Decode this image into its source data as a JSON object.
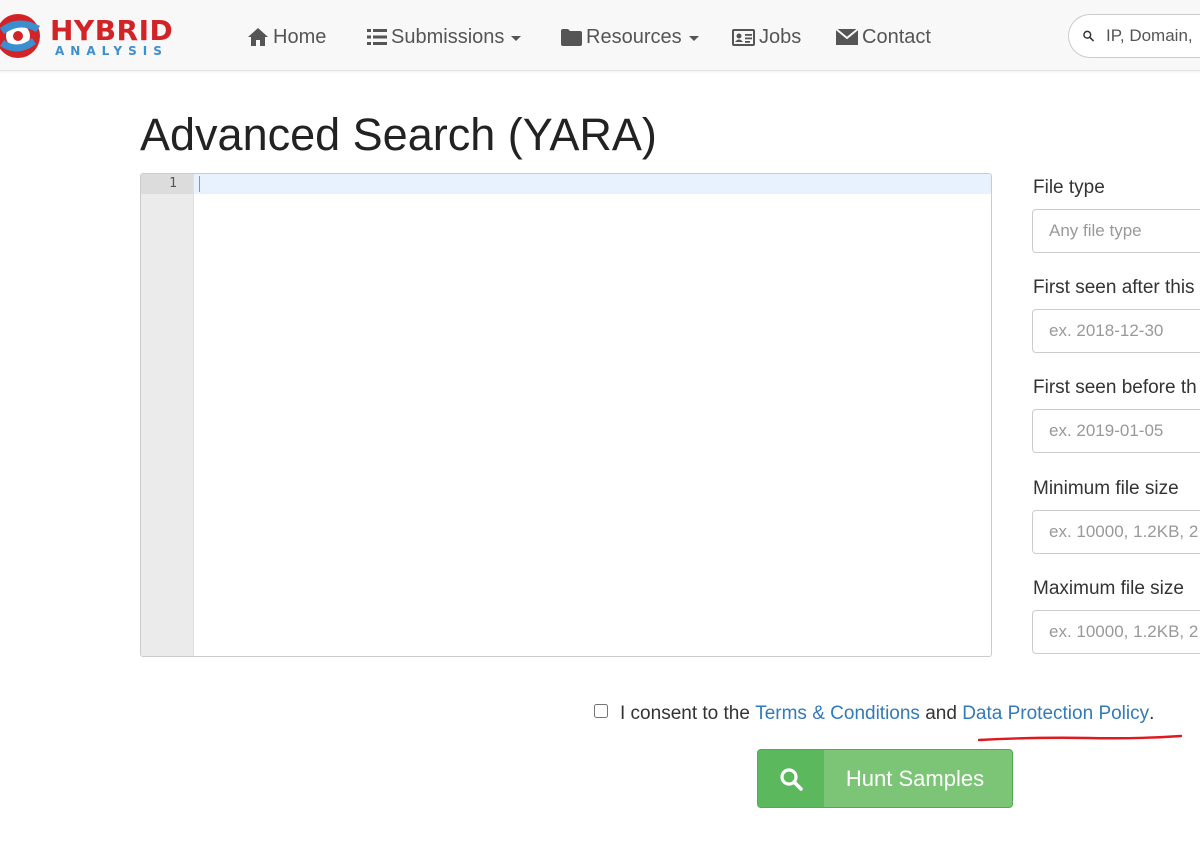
{
  "brand": {
    "name": "HYBRID",
    "tagline": "ANALYSIS"
  },
  "nav": {
    "items": [
      {
        "label": "Home",
        "icon": "home-icon"
      },
      {
        "label": "Submissions",
        "icon": "list-icon",
        "dropdown": true
      },
      {
        "label": "Resources",
        "icon": "folder-icon",
        "dropdown": true
      },
      {
        "label": "Jobs",
        "icon": "id-card-icon"
      },
      {
        "label": "Contact",
        "icon": "envelope-icon"
      }
    ],
    "search_placeholder": "IP, Domain,"
  },
  "page": {
    "title": "Advanced Search (YARA)"
  },
  "editor": {
    "line_numbers": [
      "1"
    ],
    "content": ""
  },
  "filters": {
    "file_type": {
      "label": "File type",
      "placeholder": "Any file type"
    },
    "seen_after": {
      "label": "First seen after this",
      "placeholder": "ex. 2018-12-30"
    },
    "seen_before": {
      "label": "First seen before th",
      "placeholder": "ex. 2019-01-05"
    },
    "min_size": {
      "label": "Minimum file size",
      "placeholder": "ex. 10000, 1.2KB, 2."
    },
    "max_size": {
      "label": "Maximum file size",
      "placeholder": "ex. 10000, 1.2KB, 2."
    }
  },
  "consent": {
    "prefix": "I consent to the",
    "terms_link": "Terms & Conditions",
    "conjunction": "and",
    "policy_link": "Data Protection Policy",
    "suffix": ".",
    "checked": false
  },
  "submit": {
    "label": "Hunt Samples",
    "icon": "search-icon"
  },
  "colors": {
    "brand_red": "#d22327",
    "brand_blue": "#3b8fd1",
    "link": "#337ab7",
    "button_green": "#5cb85c",
    "annotation_red": "#e0191f"
  }
}
